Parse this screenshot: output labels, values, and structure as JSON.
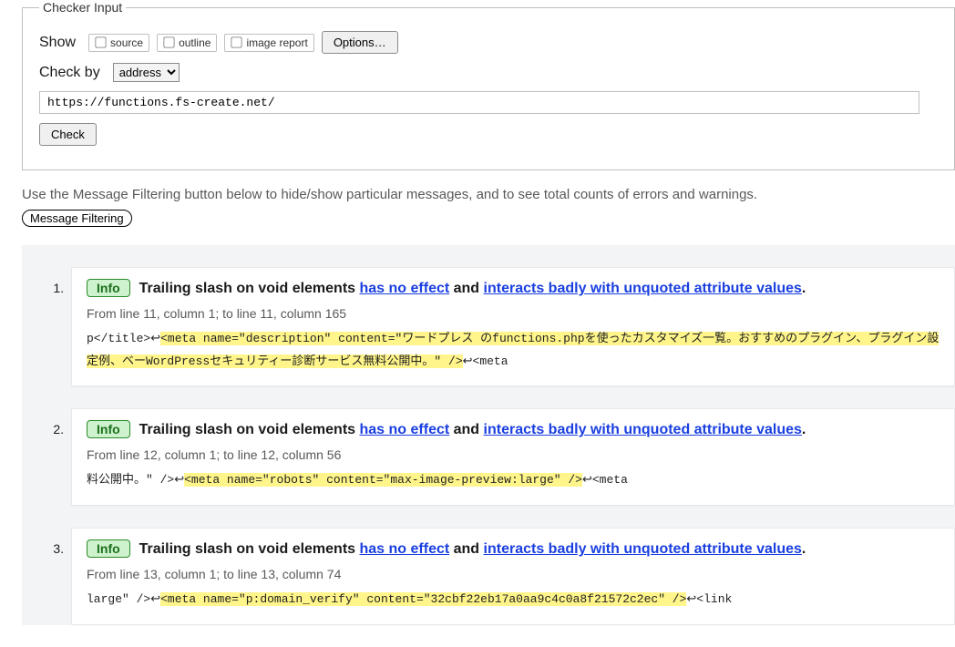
{
  "checker": {
    "legend": "Checker Input",
    "showLabel": "Show",
    "opts": {
      "source": "source",
      "outline": "outline",
      "imageReport": "image report"
    },
    "optionsBtn": "Options…",
    "checkByLabel": "Check by",
    "checkByOption": "address",
    "url": "https://functions.fs-create.net/",
    "checkBtn": "Check"
  },
  "intro": "Use the Message Filtering button below to hide/show particular messages, and to see total counts of errors and warnings.",
  "filterBtn": "Message Filtering",
  "messages": [
    {
      "severity": "Info",
      "prefix": "Trailing slash on void elements ",
      "link1": "has no effect",
      "mid": " and ",
      "link2": "interacts badly with unquoted attribute values",
      "suffix": ".",
      "location": "From line 11, column 1; to line 11, column 165",
      "pre": "p</title>↩",
      "hl": "<meta name=\"description\" content=\"ワードプレス のfunctions.phpを使ったカスタマイズ一覧。おすすめのプラグイン、プラグイン設定例、ベーWordPressセキュリティー診断サービス無料公開中。\" />",
      "post": "↩<meta"
    },
    {
      "severity": "Info",
      "prefix": "Trailing slash on void elements ",
      "link1": "has no effect",
      "mid": " and ",
      "link2": "interacts badly with unquoted attribute values",
      "suffix": ".",
      "location": "From line 12, column 1; to line 12, column 56",
      "pre": "料公開中。\" />↩",
      "hl": "<meta name=\"robots\" content=\"max-image-preview:large\" />",
      "post": "↩<meta"
    },
    {
      "severity": "Info",
      "prefix": "Trailing slash on void elements ",
      "link1": "has no effect",
      "mid": " and ",
      "link2": "interacts badly with unquoted attribute values",
      "suffix": ".",
      "location": "From line 13, column 1; to line 13, column 74",
      "pre": "large\" />↩",
      "hl": "<meta name=\"p:domain_verify\" content=\"32cbf22eb17a0aa9c4c0a8f21572c2ec\" />",
      "post": "↩<link"
    }
  ]
}
